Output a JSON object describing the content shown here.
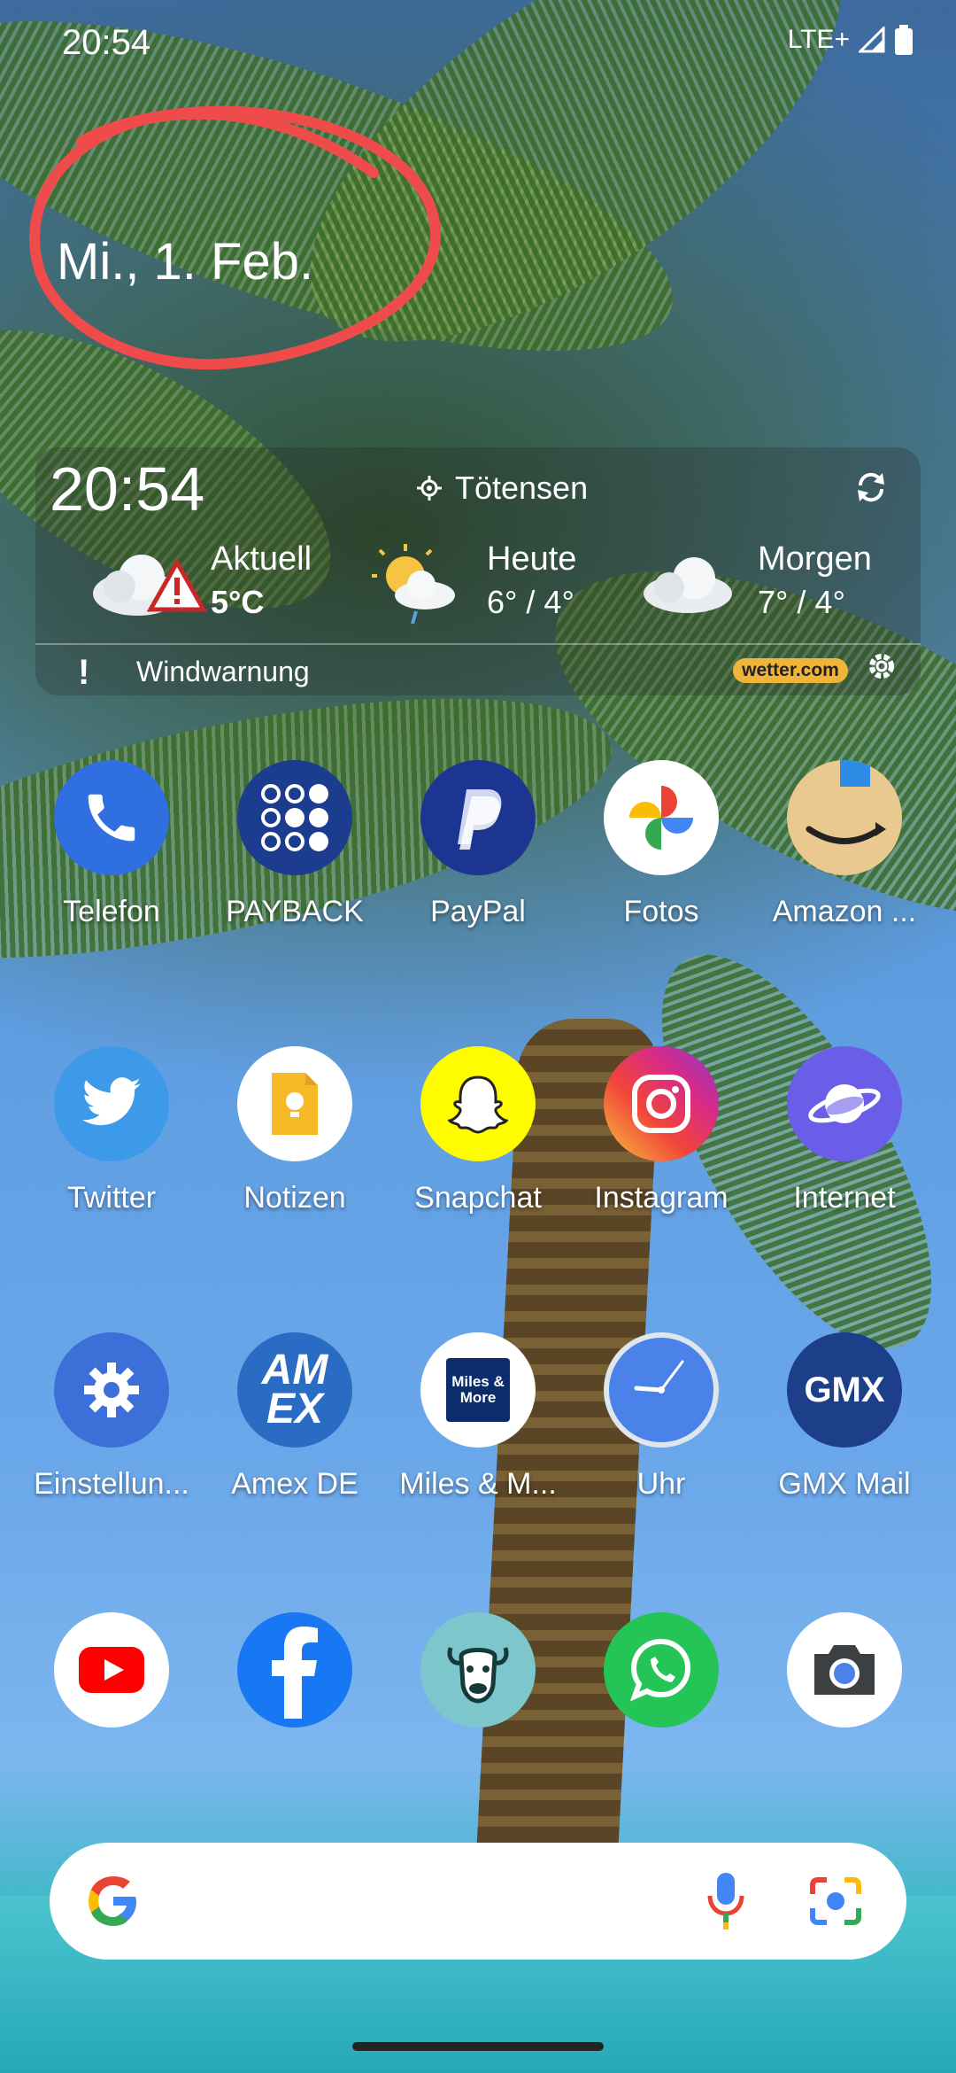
{
  "status": {
    "time": "20:54",
    "network": "LTE+"
  },
  "date": "Mi., 1. Feb.",
  "weather": {
    "time": "20:54",
    "location": "Tötensen",
    "current_label": "Aktuell",
    "current_temp": "5°C",
    "today_label": "Heute",
    "today_temp": "6° / 4°",
    "tomorrow_label": "Morgen",
    "tomorrow_temp": "7° / 4°",
    "warning_mark": "!",
    "warning": "Windwarnung",
    "brand": "wetter.com"
  },
  "apps": [
    {
      "label": "Telefon"
    },
    {
      "label": "PAYBACK"
    },
    {
      "label": "PayPal"
    },
    {
      "label": "Fotos"
    },
    {
      "label": "Amazon ..."
    },
    {
      "label": "Twitter"
    },
    {
      "label": "Notizen"
    },
    {
      "label": "Snapchat"
    },
    {
      "label": "Instagram"
    },
    {
      "label": "Internet"
    },
    {
      "label": "Einstellun..."
    },
    {
      "label": "Amex DE"
    },
    {
      "label": "Miles & M..."
    },
    {
      "label": "Uhr"
    },
    {
      "label": "GMX Mail"
    }
  ],
  "icon_text": {
    "amex": "AM EX",
    "miles": "Miles & More",
    "gmx": "GMX"
  },
  "colors": {
    "annotation": "#ef4b4b",
    "wetter_badge": "#f0b43a"
  }
}
